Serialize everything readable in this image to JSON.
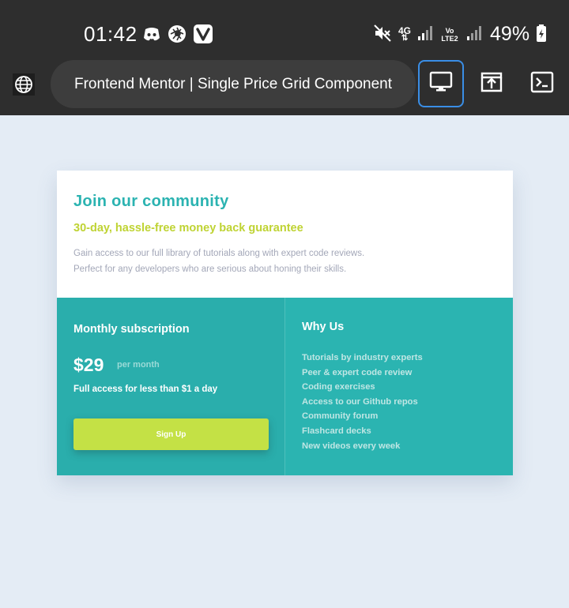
{
  "status_bar": {
    "time": "01:42",
    "network_label": "4G",
    "volte_label": "Vo LTE2",
    "battery": "49%",
    "left_icons": [
      "discord-icon",
      "aperture-icon",
      "vivaldi-icon"
    ],
    "right_icons": [
      "mute-icon",
      "signal-icon",
      "battery-icon"
    ]
  },
  "browser": {
    "url_title": "Frontend Mentor | Single Price Grid Component",
    "buttons": [
      "globe-icon",
      "desktop-icon",
      "share-icon",
      "terminal-icon"
    ],
    "accent_color": "#3a8ee6"
  },
  "card": {
    "heading": "Join our community",
    "subheading": "30-day, hassle-free money back guarantee",
    "description_line1": "Gain access to our full library of tutorials along with expert code reviews.",
    "description_line2": "Perfect for any developers who are serious about honing their skills.",
    "subscription": {
      "title": "Monthly subscription",
      "price": "$29",
      "period": "per month",
      "note": "Full access for less than $1 a day",
      "button_label": "Sign Up"
    },
    "why_us": {
      "title": "Why Us",
      "items": [
        "Tutorials by industry experts",
        "Peer & expert code review",
        "Coding exercises",
        "Access to our Github repos",
        "Community forum",
        "Flashcard decks",
        "New videos every week"
      ]
    },
    "colors": {
      "cyan": "#2bb3b1",
      "lime": "#bfd333",
      "button": "#c4e145",
      "text_grey": "#a3a7b8"
    }
  }
}
